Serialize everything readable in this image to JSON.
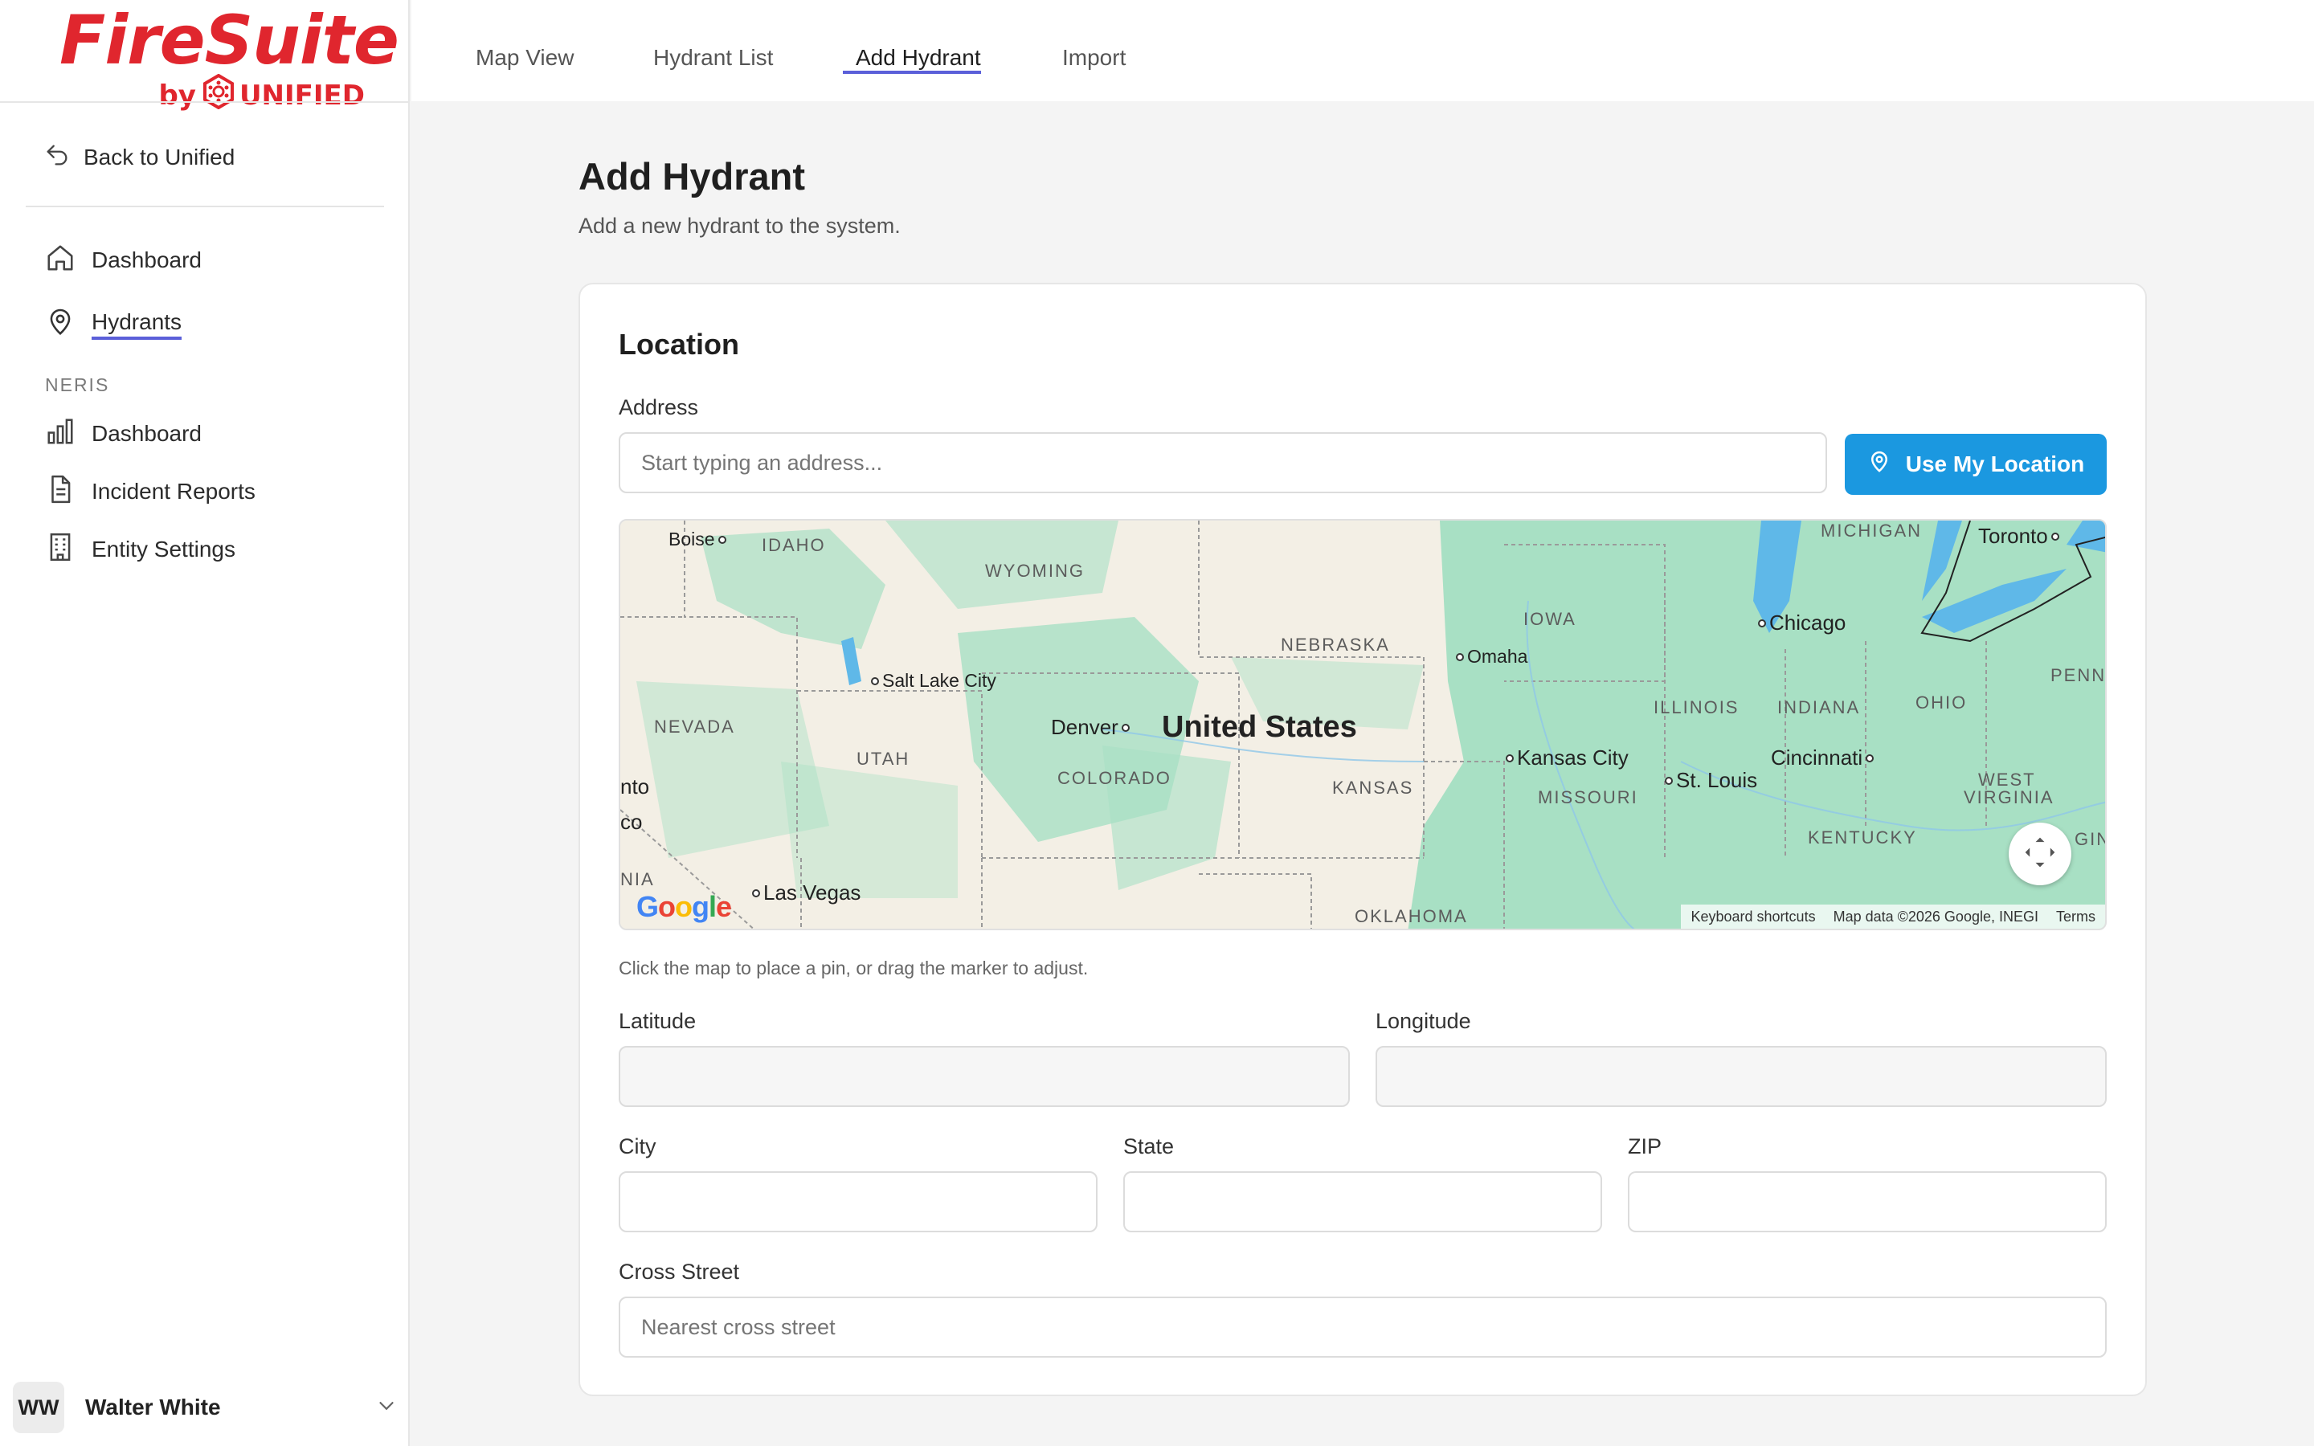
{
  "brand": {
    "name": "FireSuite",
    "by": "by",
    "company": "UNIFIED"
  },
  "sidebar": {
    "back_label": "Back to Unified",
    "items": [
      {
        "label": "Dashboard",
        "icon": "home-icon"
      },
      {
        "label": "Hydrants",
        "icon": "map-pin-icon",
        "active": true
      }
    ],
    "section_label": "NERIS",
    "neris_items": [
      {
        "label": "Dashboard",
        "icon": "bar-chart-icon"
      },
      {
        "label": "Incident Reports",
        "icon": "document-icon"
      },
      {
        "label": "Entity Settings",
        "icon": "building-icon"
      }
    ],
    "user": {
      "initials": "WW",
      "name": "Walter White"
    }
  },
  "topnav": {
    "tabs": [
      {
        "label": "Map View"
      },
      {
        "label": "Hydrant List"
      },
      {
        "label": "Add Hydrant",
        "active": true
      },
      {
        "label": "Import"
      }
    ]
  },
  "page": {
    "title": "Add Hydrant",
    "subtitle": "Add a new hydrant to the system."
  },
  "form": {
    "section_title": "Location",
    "address_label": "Address",
    "address_placeholder": "Start typing an address...",
    "use_location_label": "Use My Location",
    "hint": "Click the map to place a pin, or drag the marker to adjust.",
    "latitude_label": "Latitude",
    "longitude_label": "Longitude",
    "city_label": "City",
    "state_label": "State",
    "zip_label": "ZIP",
    "cross_street_label": "Cross Street",
    "cross_street_placeholder": "Nearest cross street"
  },
  "map": {
    "country": "United States",
    "states": [
      "IDAHO",
      "WYOMING",
      "NEBRASKA",
      "IOWA",
      "MICHIGAN",
      "NEVADA",
      "UTAH",
      "COLORADO",
      "KANSAS",
      "ILLINOIS",
      "INDIANA",
      "OHIO",
      "PENN",
      "MISSOURI",
      "WEST",
      "VIRGINIA",
      "KENTUCKY",
      "OKLAHOMA",
      "NIA",
      "GIN"
    ],
    "cities": [
      "Boise",
      "Salt Lake City",
      "Omaha",
      "Chicago",
      "Toronto",
      "Denver",
      "Kansas City",
      "St. Louis",
      "Cincinnati",
      "Las Vegas"
    ],
    "edge_labels": [
      "nto",
      "co"
    ],
    "google": "Google",
    "attribution": {
      "shortcuts": "Keyboard shortcuts",
      "data": "Map data ©2026 Google, INEGI",
      "terms": "Terms"
    },
    "colors": {
      "land": "#f3efe5",
      "park": "#a8e0c4",
      "water": "#5fb8e8"
    }
  },
  "colors": {
    "brand_red": "#e0262e",
    "accent_blue": "#1b98e0",
    "active_underline": "#5b5fd9"
  }
}
